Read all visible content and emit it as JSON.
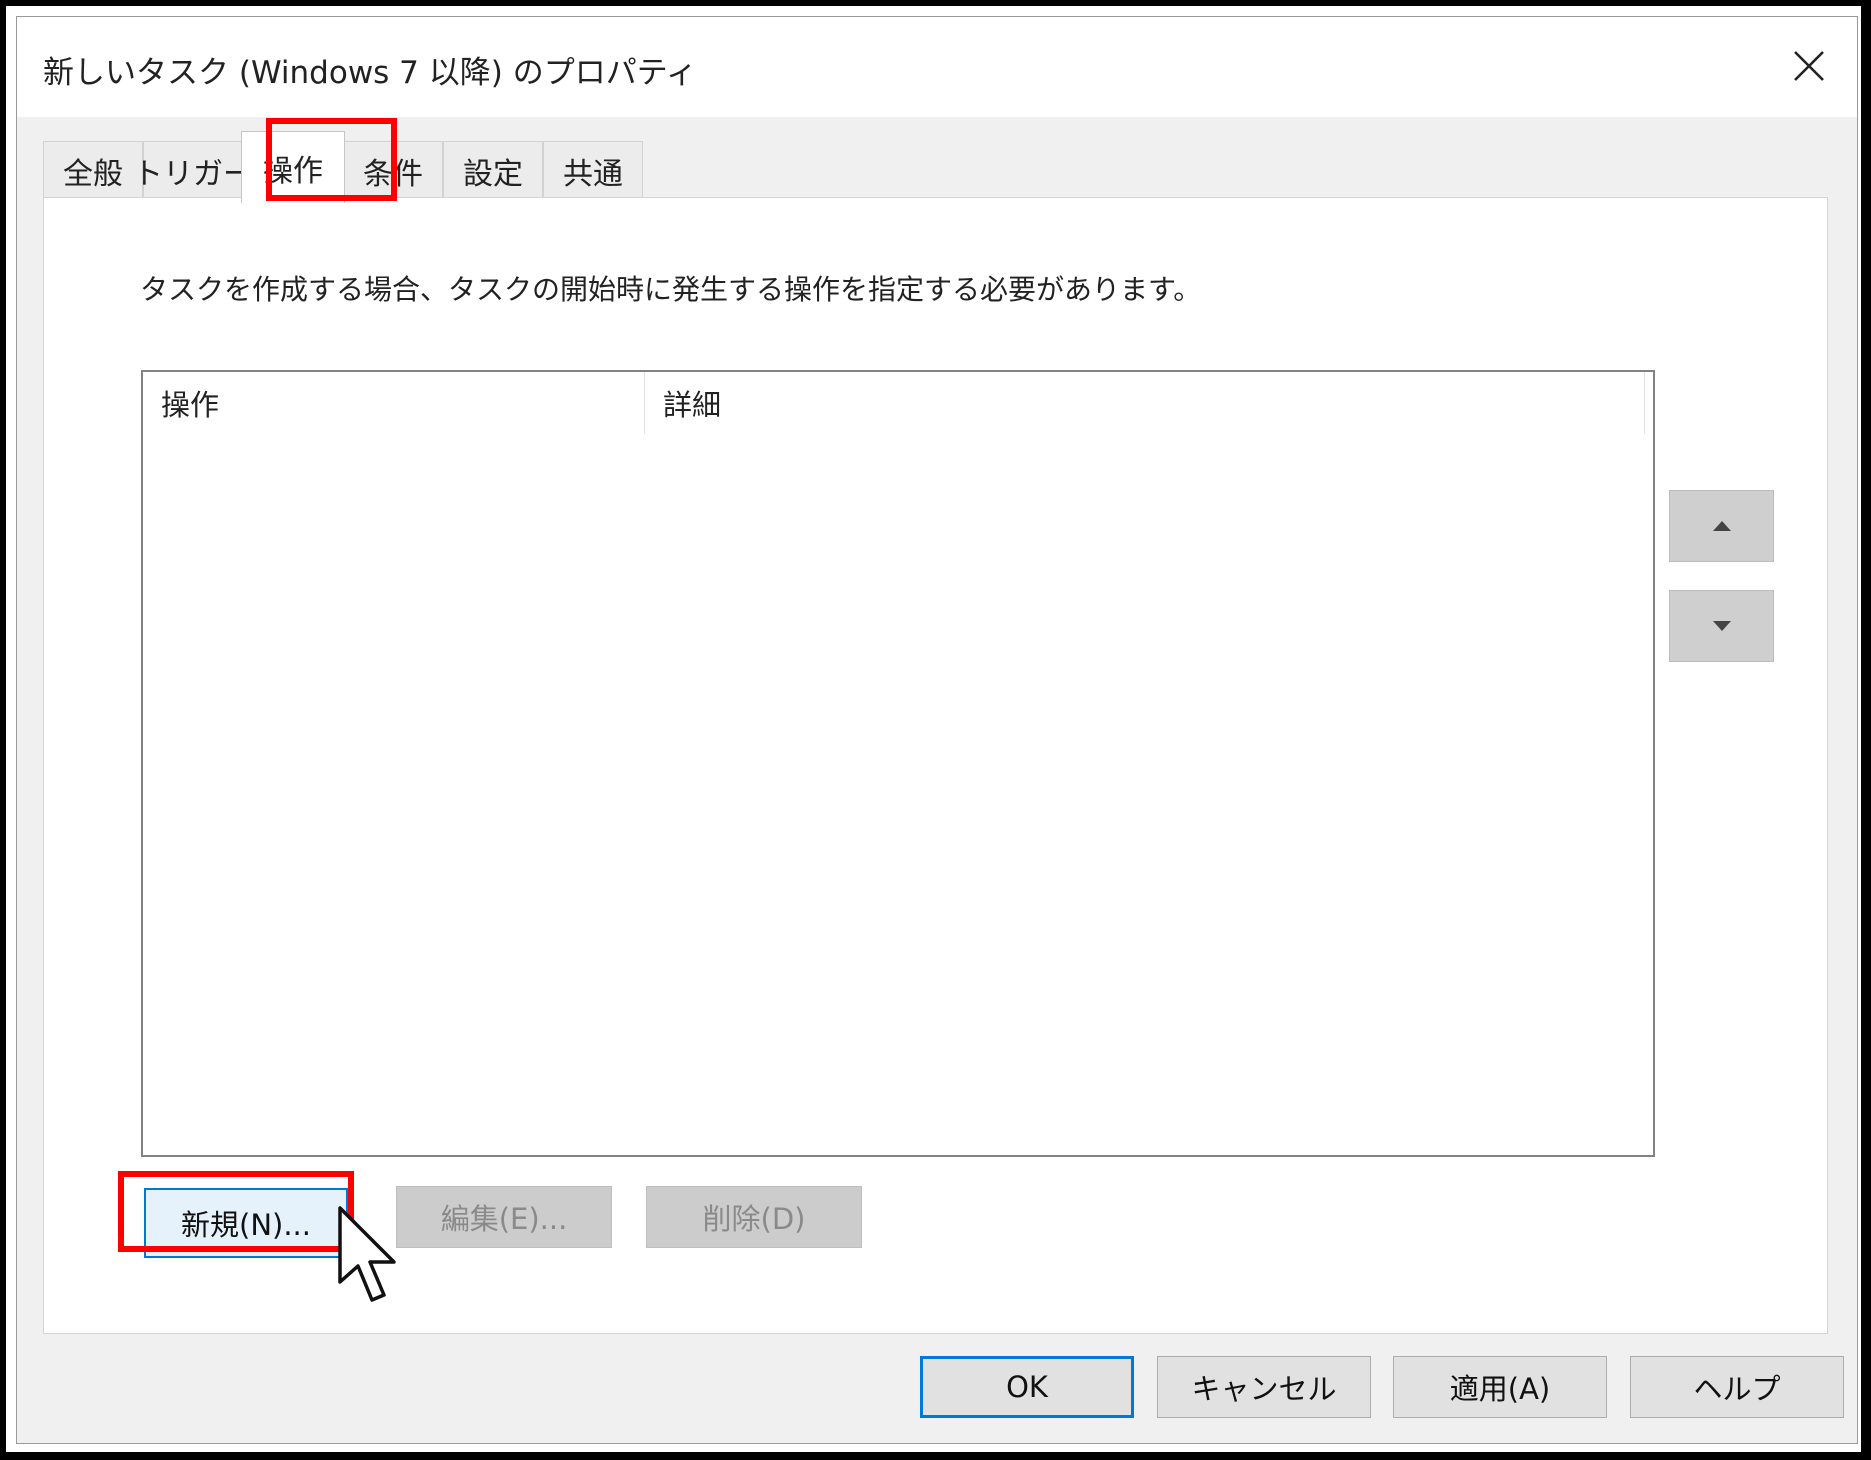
{
  "dialog": {
    "title": "新しいタスク (Windows 7 以降) のプロパティ",
    "close_icon": "close-icon"
  },
  "tabs": [
    {
      "label": "全般"
    },
    {
      "label": "トリガー"
    },
    {
      "label": "操作",
      "active": true
    },
    {
      "label": "条件"
    },
    {
      "label": "設定"
    },
    {
      "label": "共通"
    }
  ],
  "actions_panel": {
    "description": "タスクを作成する場合、タスクの開始時に発生する操作を指定する必要があります。",
    "columns": [
      "操作",
      "詳細"
    ],
    "rows": [],
    "move_up_icon": "triangle-up-icon",
    "move_down_icon": "triangle-down-icon",
    "buttons": {
      "new": "新規(N)...",
      "edit": "編集(E)...",
      "delete": "削除(D)"
    }
  },
  "footer": {
    "ok": "OK",
    "cancel": "キャンセル",
    "apply": "適用(A)",
    "help": "ヘルプ"
  },
  "colors": {
    "highlight": "#ff0000",
    "accent": "#0078d7"
  }
}
